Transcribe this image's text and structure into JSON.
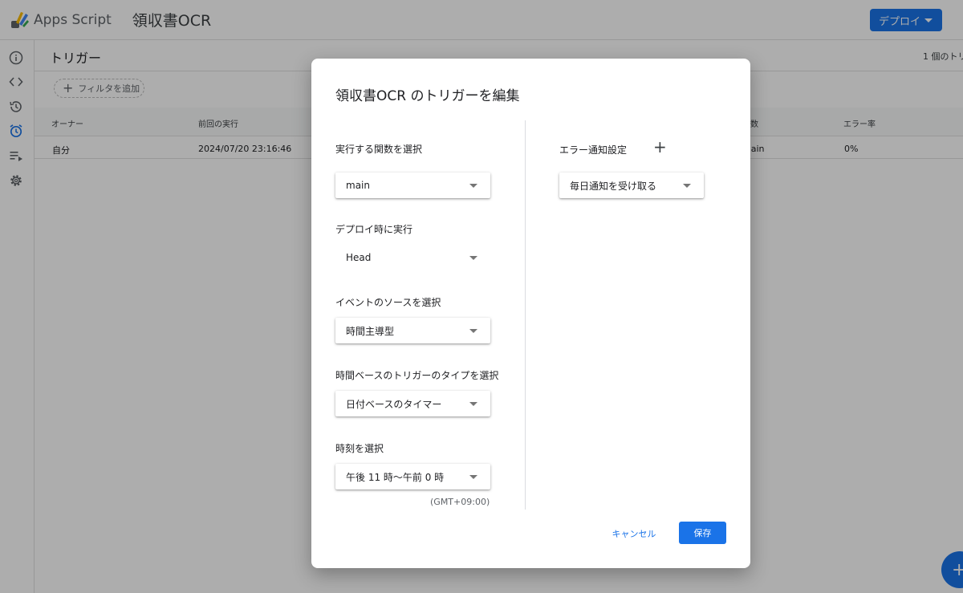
{
  "header": {
    "app_name": "Apps Script",
    "project_name": "領収書OCR",
    "deploy_label": "デプロイ"
  },
  "sidebar": {
    "icons": [
      "info-icon",
      "code-icon",
      "history-icon",
      "alarm-icon",
      "executions-icon",
      "gear-icon"
    ],
    "active": "alarm-icon"
  },
  "main": {
    "title": "トリガー",
    "trigger_count": "1 個のトリ",
    "filter_label": "フィルタを追加",
    "columns": [
      "オーナー",
      "前回の実行",
      "関数",
      "エラー率"
    ],
    "rows": [
      {
        "owner": "自分",
        "last_run": "2024/07/20 23:16:46",
        "function": "main",
        "error_rate": "0%"
      }
    ]
  },
  "dialog": {
    "title": "領収書OCR のトリガーを編集",
    "function_label": "実行する関数を選択",
    "function_value": "main",
    "deployment_label": "デプロイ時に実行",
    "deployment_value": "Head",
    "event_source_label": "イベントのソースを選択",
    "event_source_value": "時間主導型",
    "timer_type_label": "時間ベースのトリガーのタイプを選択",
    "timer_type_value": "日付ベースのタイマー",
    "time_label": "時刻を選択",
    "time_value": "午後 11 時～午前 0 時",
    "timezone": "(GMT+09:00)",
    "error_label": "エラー通知設定",
    "error_value": "毎日通知を受け取る",
    "cancel_label": "キャンセル",
    "save_label": "保存"
  },
  "colors": {
    "accent": "#1a73e8",
    "overlay": "rgba(0,0,0,0.32)"
  }
}
